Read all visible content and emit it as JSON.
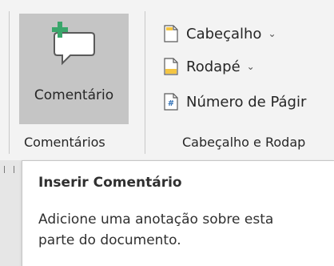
{
  "ribbon": {
    "comments_group": {
      "button_label": "Comentário",
      "group_label": "Comentários",
      "icon": "new-comment-icon"
    },
    "header_footer_group": {
      "items": [
        {
          "label": "Cabeçalho",
          "icon": "header-icon",
          "has_dropdown": true
        },
        {
          "label": "Rodapé",
          "icon": "footer-icon",
          "has_dropdown": true
        },
        {
          "label": "Número de Págir",
          "icon": "page-number-icon",
          "has_dropdown": false
        }
      ],
      "group_label": "Cabeçalho e Rodap"
    }
  },
  "tooltip": {
    "title": "Inserir Comentário",
    "description": "Adicione uma anotação sobre esta parte do documento."
  },
  "colors": {
    "ribbon_bg": "#f3f3f3",
    "pressed_button_bg": "#c5c5c5",
    "accent_green": "#3aa66b",
    "footer_icon_fill": "#f4c542"
  }
}
